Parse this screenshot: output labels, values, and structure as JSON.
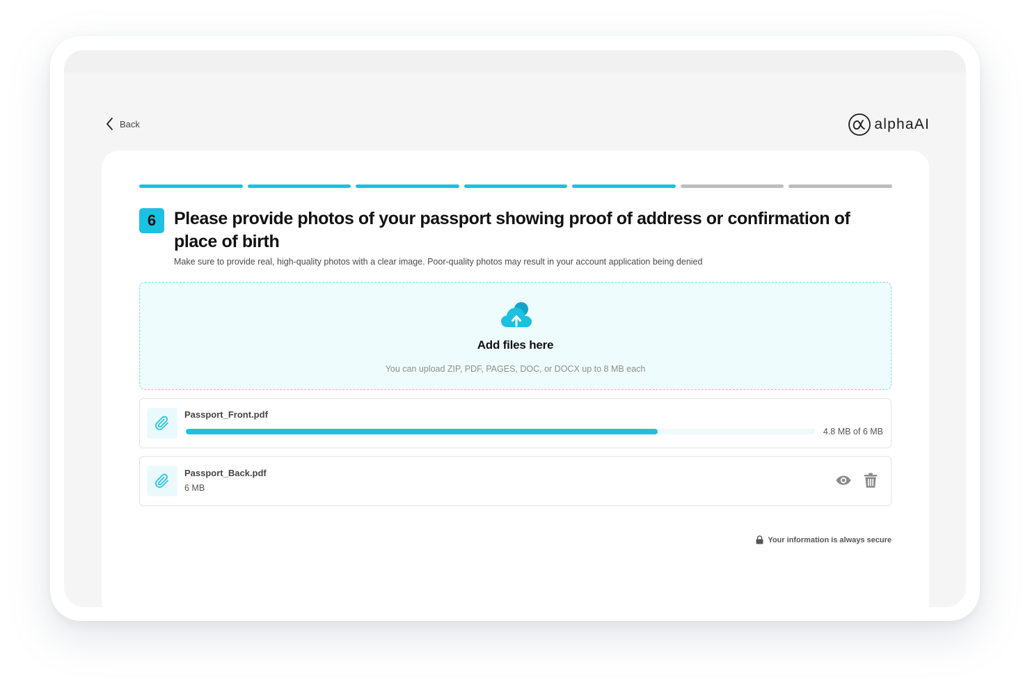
{
  "nav": {
    "back_label": "Back"
  },
  "brand": {
    "logo_text": "alphaAI"
  },
  "progress": {
    "total_steps": 7,
    "completed_steps": 5,
    "accent_color": "#1cc1e2",
    "pending_color": "#bdbdbd"
  },
  "question": {
    "step_number": "6",
    "title": "Please provide photos of your passport showing proof of address or confirmation of place of birth",
    "hint": "Make sure to provide real, high-quality photos with a clear image. Poor-quality photos may result in your account application being denied"
  },
  "dropzone": {
    "icon": "cloud-upload-icon",
    "title": "Add files here",
    "subtitle": "You can upload ZIP, PDF, PAGES, DOC, or DOCX up to 8 MB each"
  },
  "files": [
    {
      "name": "Passport_Front.pdf",
      "status": "uploading",
      "progress_fraction": 0.75,
      "progress_text": "4.8 MB of 6 MB"
    },
    {
      "name": "Passport_Back.pdf",
      "status": "uploaded",
      "size": "6 MB",
      "actions": [
        "eye-icon",
        "trash-icon"
      ]
    }
  ],
  "footer": {
    "secure_text": "Your information is always secure",
    "icon": "lock-icon"
  }
}
